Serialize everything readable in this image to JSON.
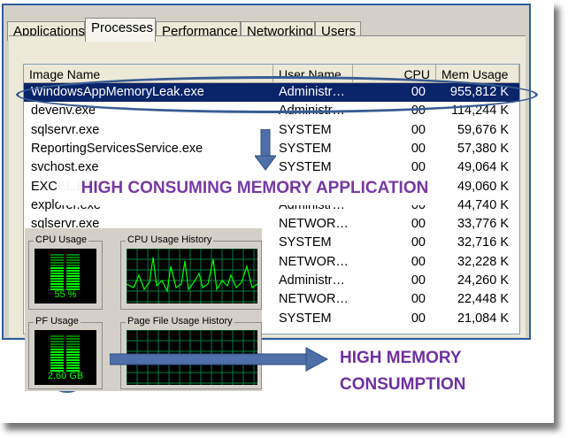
{
  "tabs": [
    "Applications",
    "Processes",
    "Performance",
    "Networking",
    "Users"
  ],
  "active_tab": "Processes",
  "columns": [
    "Image Name",
    "User Name",
    "CPU",
    "Mem Usage"
  ],
  "processes": [
    {
      "name": "WindowsAppMemoryLeak.exe",
      "user": "Administr…",
      "cpu": "00",
      "mem": "955,812 K"
    },
    {
      "name": "devenv.exe",
      "user": "Administr…",
      "cpu": "00",
      "mem": "114,244 K"
    },
    {
      "name": "sqlservr.exe",
      "user": "SYSTEM",
      "cpu": "00",
      "mem": "59,676 K"
    },
    {
      "name": "ReportingServicesService.exe",
      "user": "SYSTEM",
      "cpu": "00",
      "mem": "57,380 K"
    },
    {
      "name": "svchost.exe",
      "user": "SYSTEM",
      "cpu": "00",
      "mem": "49,064 K"
    },
    {
      "name": "EXCEL.EXE",
      "user": "Administr…",
      "cpu": "00",
      "mem": "49,060 K"
    },
    {
      "name": "explorer.exe",
      "user": "Administr…",
      "cpu": "00",
      "mem": "44,740 K"
    },
    {
      "name": "sqlservr.exe",
      "user": "NETWOR…",
      "cpu": "00",
      "mem": "33,776 K"
    },
    {
      "name": "",
      "user": "SYSTEM",
      "cpu": "00",
      "mem": "32,716 K"
    },
    {
      "name": "",
      "user": "NETWOR…",
      "cpu": "00",
      "mem": "32,228 K"
    },
    {
      "name": "",
      "user": "Administr…",
      "cpu": "00",
      "mem": "24,260 K"
    },
    {
      "name": "",
      "user": "NETWOR…",
      "cpu": "00",
      "mem": "22,448 K"
    },
    {
      "name": "",
      "user": "SYSTEM",
      "cpu": "00",
      "mem": "21,084 K"
    }
  ],
  "callouts": {
    "app": "HIGH CONSUMING MEMORY APPLICATION",
    "memory_line1": "HIGH MEMORY",
    "memory_line2": "CONSUMPTION"
  },
  "performance": {
    "cpu_usage_label": "CPU Usage",
    "cpu_usage_value": "55 %",
    "cpu_history_label": "CPU Usage History",
    "pf_usage_label": "PF Usage",
    "pf_usage_value": "2.60 GB",
    "pf_history_label": "Page File Usage History"
  },
  "colors": {
    "annotation_blue": "#3a5c92",
    "callout_purple": "#7030a0",
    "selection": "#0a246a",
    "meter_green": "#00ff00"
  }
}
